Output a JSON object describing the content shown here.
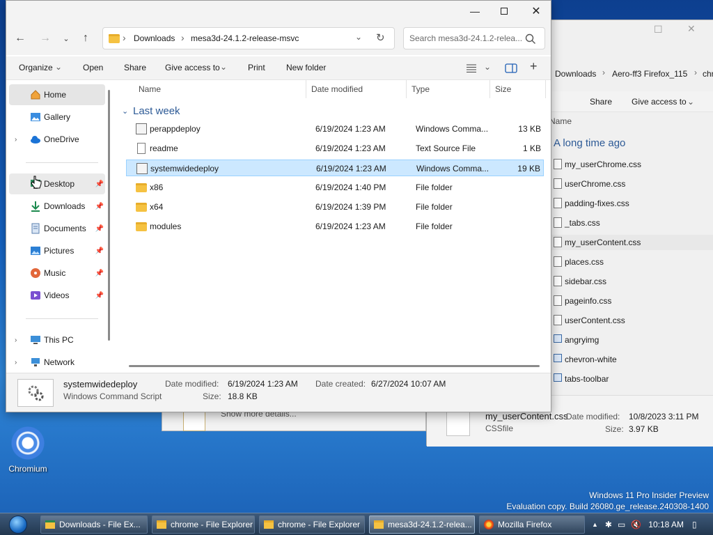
{
  "desktop": {
    "chromium_label": "Chromium",
    "watermark_line1": "Windows 11 Pro Insider Preview",
    "watermark_line2": "Evaluation copy. Build 26080.ge_release.240308-1400"
  },
  "back_window_2": {
    "hint": "Show more details..."
  },
  "back_window_1": {
    "breadcrumb": [
      "Downloads",
      "Aero-ff3 Firefox_115",
      "chr"
    ],
    "commands": [
      "Share",
      "Give access to"
    ],
    "col_name": "Name",
    "group": "A long time ago",
    "files": [
      {
        "name": "my_userChrome.css",
        "kind": "file"
      },
      {
        "name": "userChrome.css",
        "kind": "file"
      },
      {
        "name": "padding-fixes.css",
        "kind": "file"
      },
      {
        "name": "_tabs.css",
        "kind": "file"
      },
      {
        "name": "my_userContent.css",
        "kind": "file",
        "selected": true
      },
      {
        "name": "places.css",
        "kind": "file"
      },
      {
        "name": "sidebar.css",
        "kind": "file"
      },
      {
        "name": "pageinfo.css",
        "kind": "file"
      },
      {
        "name": "userContent.css",
        "kind": "file"
      },
      {
        "name": "angryimg",
        "kind": "image"
      },
      {
        "name": "chevron-white",
        "kind": "image"
      },
      {
        "name": "tabs-toolbar",
        "kind": "image"
      }
    ],
    "details": {
      "name": "my_userContent.css",
      "type": "CSSfile",
      "modified_label": "Date modified:",
      "modified": "10/8/2023 3:11 PM",
      "size_label": "Size:",
      "size": "3.97 KB"
    }
  },
  "main_window": {
    "breadcrumb": [
      "Downloads",
      "mesa3d-24.1.2-release-msvc"
    ],
    "search_placeholder": "Search mesa3d-24.1.2-relea...",
    "commands": {
      "organize": "Organize",
      "open": "Open",
      "share": "Share",
      "give_access": "Give access to",
      "print": "Print",
      "new_folder": "New folder"
    },
    "nav": {
      "home": "Home",
      "gallery": "Gallery",
      "onedrive": "OneDrive",
      "desktop": "Desktop",
      "downloads": "Downloads",
      "documents": "Documents",
      "pictures": "Pictures",
      "music": "Music",
      "videos": "Videos",
      "this_pc": "This PC",
      "network": "Network"
    },
    "columns": {
      "name": "Name",
      "date": "Date modified",
      "type": "Type",
      "size": "Size"
    },
    "group": "Last week",
    "files": [
      {
        "name": "perappdeploy",
        "date": "6/19/2024 1:23 AM",
        "type": "Windows Comma...",
        "size": "13 KB",
        "kind": "script"
      },
      {
        "name": "readme",
        "date": "6/19/2024 1:23 AM",
        "type": "Text Source File",
        "size": "1 KB",
        "kind": "text"
      },
      {
        "name": "systemwidedeploy",
        "date": "6/19/2024 1:23 AM",
        "type": "Windows Comma...",
        "size": "19 KB",
        "kind": "script",
        "selected": true
      },
      {
        "name": "x86",
        "date": "6/19/2024 1:40 PM",
        "type": "File folder",
        "size": "",
        "kind": "folder"
      },
      {
        "name": "x64",
        "date": "6/19/2024 1:39 PM",
        "type": "File folder",
        "size": "",
        "kind": "folder"
      },
      {
        "name": "modules",
        "date": "6/19/2024 1:23 AM",
        "type": "File folder",
        "size": "",
        "kind": "folder"
      }
    ],
    "details": {
      "name": "systemwidedeploy",
      "type": "Windows Command Script",
      "modified_label": "Date modified:",
      "modified": "6/19/2024 1:23 AM",
      "created_label": "Date created:",
      "created": "6/27/2024 10:07 AM",
      "size_label": "Size:",
      "size": "18.8 KB"
    }
  },
  "taskbar": {
    "tasks": [
      {
        "label": "Downloads - File Ex...",
        "icon": "explorer-icon"
      },
      {
        "label": "chrome - File Explorer",
        "icon": "folder-icon"
      },
      {
        "label": "chrome - File Explorer",
        "icon": "folder-icon"
      },
      {
        "label": "mesa3d-24.1.2-relea...",
        "icon": "folder-icon",
        "active": true
      },
      {
        "label": "Mozilla Firefox",
        "icon": "firefox-icon"
      }
    ],
    "clock": "10:18 AM"
  }
}
